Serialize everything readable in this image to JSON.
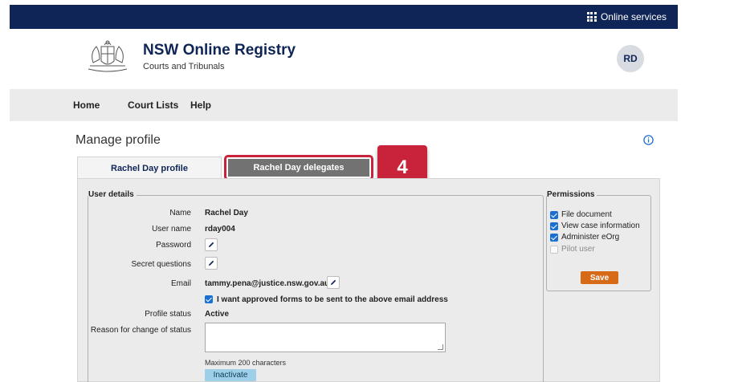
{
  "topbar": {
    "online_services": "Online services",
    "icon": "apps-grid-icon"
  },
  "header": {
    "title": "NSW Online Registry",
    "subtitle": "Courts and Tribunals",
    "avatar_initials": "RD",
    "logo": "nsw-coat-of-arms"
  },
  "nav": {
    "items": [
      "Home",
      "Court Lists",
      "Help"
    ]
  },
  "page": {
    "title": "Manage profile",
    "info_icon": "info-icon"
  },
  "tabs": [
    {
      "label": "Rachel Day profile",
      "active": true
    },
    {
      "label": "Rachel Day delegates",
      "active": false,
      "highlighted": true
    }
  ],
  "step_badge": "4",
  "user_details": {
    "legend": "User details",
    "name_label": "Name",
    "name_value": "Rachel Day",
    "username_label": "User name",
    "username_value": "rday004",
    "password_label": "Password",
    "secret_label": "Secret questions",
    "email_label": "Email",
    "email_value": "tammy.pena@justice.nsw.gov.au",
    "approved_forms_label": "I want approved forms to be sent to the above email address",
    "approved_forms_checked": true,
    "status_label": "Profile status",
    "status_value": "Active",
    "reason_label": "Reason for change of status",
    "reason_value": "",
    "hint": "Maximum 200 characters",
    "inactivate_button": "Inactivate"
  },
  "permissions": {
    "legend": "Permissions",
    "items": [
      {
        "label": "File document",
        "checked": true
      },
      {
        "label": "View case information",
        "checked": true
      },
      {
        "label": "Administer eOrg",
        "checked": true
      },
      {
        "label": "Pilot user",
        "checked": false
      }
    ],
    "save_button": "Save"
  },
  "colors": {
    "navy": "#0f2557",
    "highlight": "#c8233b",
    "save": "#d66a17",
    "inactivate": "#9dd0e8",
    "checkbox": "#1a6fd3"
  }
}
